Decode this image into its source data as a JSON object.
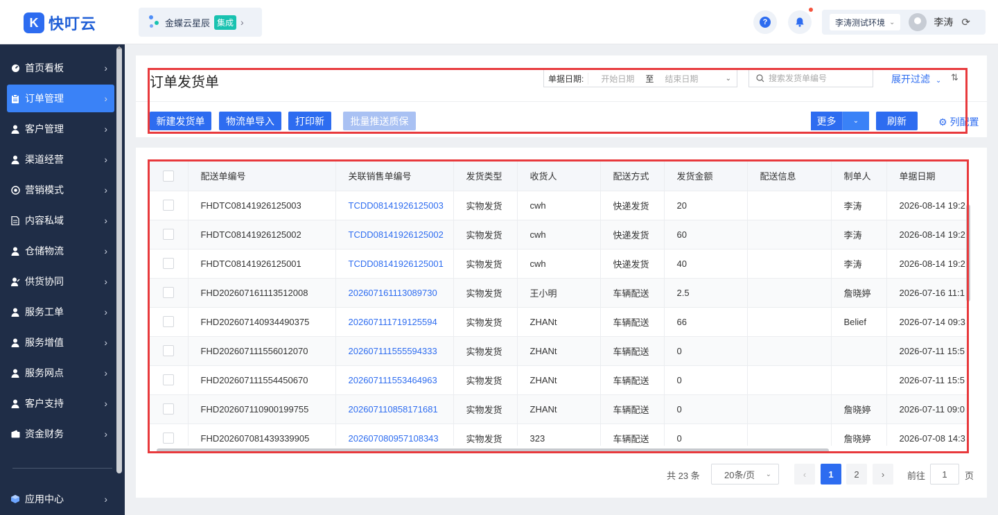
{
  "app": {
    "logo_letter": "K",
    "name": "快叮云"
  },
  "integration": {
    "name": "金蝶云星辰",
    "badge": "集成"
  },
  "header": {
    "env_label": "李涛测试环境",
    "username": "李涛"
  },
  "sidebar": {
    "items": [
      {
        "label": "首页看板",
        "icon": "dashboard-icon"
      },
      {
        "label": "订单管理",
        "icon": "clipboard-icon",
        "active": true
      },
      {
        "label": "客户管理",
        "icon": "user-icon"
      },
      {
        "label": "渠道经营",
        "icon": "user-icon"
      },
      {
        "label": "营销模式",
        "icon": "target-icon"
      },
      {
        "label": "内容私域",
        "icon": "document-icon"
      },
      {
        "label": "仓储物流",
        "icon": "user-icon"
      },
      {
        "label": "供货协同",
        "icon": "user-edit-icon"
      },
      {
        "label": "服务工单",
        "icon": "user-icon"
      },
      {
        "label": "服务增值",
        "icon": "user-icon"
      },
      {
        "label": "服务网点",
        "icon": "user-icon"
      },
      {
        "label": "客户支持",
        "icon": "user-icon"
      },
      {
        "label": "资金财务",
        "icon": "wallet-icon"
      }
    ],
    "footer_item": {
      "label": "应用中心",
      "icon": "cube-icon"
    }
  },
  "page": {
    "title": "订单发货单",
    "date_label": "单据日期:",
    "date_start_placeholder": "开始日期",
    "date_to": "至",
    "date_end_placeholder": "结束日期",
    "search_placeholder": "搜索发货单编号",
    "expand_filter": "展开过滤",
    "buttons": {
      "create": "新建发货单",
      "import": "物流单导入",
      "print": "打印新",
      "batch_push": "批量推送质保",
      "more": "更多",
      "refresh": "刷新",
      "col_config": "列配置"
    }
  },
  "table": {
    "columns": [
      "配送单编号",
      "关联销售单编号",
      "发货类型",
      "收货人",
      "配送方式",
      "发货金额",
      "配送信息",
      "制单人",
      "单据日期"
    ],
    "rows": [
      [
        "FHDTC08141926125003",
        "TCDD08141926125003",
        "实物发货",
        "cwh",
        "快递发货",
        "20",
        "",
        "李涛",
        "2026-08-14 19:2"
      ],
      [
        "FHDTC08141926125002",
        "TCDD08141926125002",
        "实物发货",
        "cwh",
        "快递发货",
        "60",
        "",
        "李涛",
        "2026-08-14 19:2"
      ],
      [
        "FHDTC08141926125001",
        "TCDD08141926125001",
        "实物发货",
        "cwh",
        "快递发货",
        "40",
        "",
        "李涛",
        "2026-08-14 19:2"
      ],
      [
        "FHD202607161113512008",
        "202607161113089730",
        "实物发货",
        "王小明",
        "车辆配送",
        "2.5",
        "",
        "詹晓婷",
        "2026-07-16 11:1"
      ],
      [
        "FHD202607140934490375",
        "202607111719125594",
        "实物发货",
        "ZHANt",
        "车辆配送",
        "66",
        "",
        "Belief",
        "2026-07-14 09:3"
      ],
      [
        "FHD202607111556012070",
        "202607111555594333",
        "实物发货",
        "ZHANt",
        "车辆配送",
        "0",
        "",
        "",
        "2026-07-11 15:5"
      ],
      [
        "FHD202607111554450670",
        "202607111553464963",
        "实物发货",
        "ZHANt",
        "车辆配送",
        "0",
        "",
        "",
        "2026-07-11 15:5"
      ],
      [
        "FHD202607110900199755",
        "202607110858171681",
        "实物发货",
        "ZHANt",
        "车辆配送",
        "0",
        "",
        "詹晓婷",
        "2026-07-11 09:0"
      ],
      [
        "FHD202607081439339905",
        "202607080957108343",
        "实物发货",
        "323",
        "车辆配送",
        "0",
        "",
        "詹晓婷",
        "2026-07-08 14:3"
      ]
    ]
  },
  "pagination": {
    "total": "共 23 条",
    "page_size": "20条/页",
    "pages": [
      "1",
      "2"
    ],
    "current": "1",
    "goto_label": "前往",
    "goto_value": "1",
    "page_suffix": "页"
  }
}
